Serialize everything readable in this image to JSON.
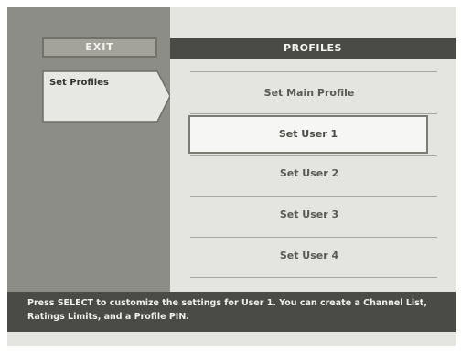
{
  "menu": {
    "exit_label": "EXIT",
    "items": [
      {
        "label": "Set Profiles"
      }
    ]
  },
  "profiles": {
    "header_title": "PROFILES",
    "options": [
      {
        "label": "Set Main Profile",
        "selected": false
      },
      {
        "label": "Set User 1",
        "selected": true
      },
      {
        "label": "Set User 2",
        "selected": false
      },
      {
        "label": "Set User 3",
        "selected": false
      },
      {
        "label": "Set User 4",
        "selected": false
      }
    ]
  },
  "status": {
    "message": "Press SELECT to customize the settings for User 1. You can create a Channel List, Ratings Limits, and a Profile PIN."
  },
  "colors": {
    "left_panel": "#8d8d87",
    "header_bar": "#4a4a46",
    "selected_bg": "#f6f6f4"
  }
}
